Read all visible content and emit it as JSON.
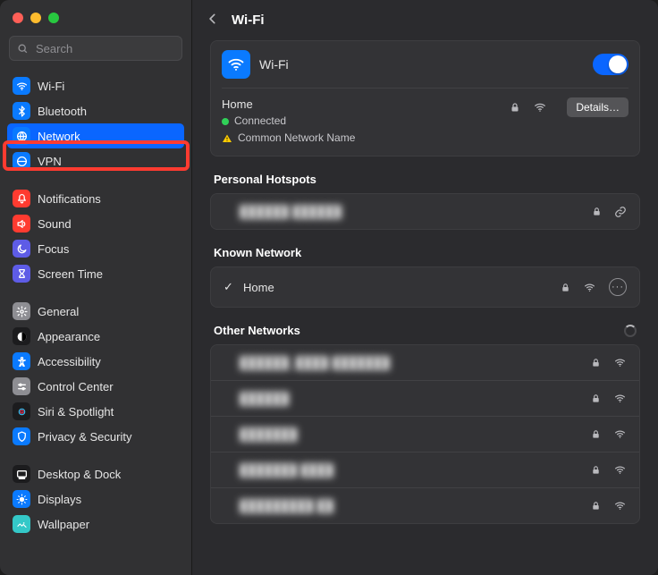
{
  "search": {
    "placeholder": "Search"
  },
  "sidebar": {
    "groups": [
      {
        "items": [
          {
            "label": "Wi-Fi",
            "icon": "wifi",
            "bg": "#0a7aff",
            "sel": false
          },
          {
            "label": "Bluetooth",
            "icon": "bt",
            "bg": "#0a7aff",
            "sel": false
          },
          {
            "label": "Network",
            "icon": "globe",
            "bg": "#0a7aff",
            "sel": true
          },
          {
            "label": "VPN",
            "icon": "vpn",
            "bg": "#0a7aff",
            "sel": false
          }
        ]
      },
      {
        "items": [
          {
            "label": "Notifications",
            "icon": "bell",
            "bg": "#ff3b30"
          },
          {
            "label": "Sound",
            "icon": "sound",
            "bg": "#ff3b30"
          },
          {
            "label": "Focus",
            "icon": "moon",
            "bg": "#5e5ce6"
          },
          {
            "label": "Screen Time",
            "icon": "hour",
            "bg": "#5e5ce6"
          }
        ]
      },
      {
        "items": [
          {
            "label": "General",
            "icon": "gear",
            "bg": "#8e8e93"
          },
          {
            "label": "Appearance",
            "icon": "appear",
            "bg": "#1c1c1e"
          },
          {
            "label": "Accessibility",
            "icon": "access",
            "bg": "#0a7aff"
          },
          {
            "label": "Control Center",
            "icon": "cc",
            "bg": "#8e8e93"
          },
          {
            "label": "Siri & Spotlight",
            "icon": "siri",
            "bg": "#1c1c1e"
          },
          {
            "label": "Privacy & Security",
            "icon": "hand",
            "bg": "#0a7aff"
          }
        ]
      },
      {
        "items": [
          {
            "label": "Desktop & Dock",
            "icon": "dock",
            "bg": "#1c1c1e"
          },
          {
            "label": "Displays",
            "icon": "display",
            "bg": "#0a7aff"
          },
          {
            "label": "Wallpaper",
            "icon": "wall",
            "bg": "#34c8c8"
          }
        ]
      }
    ]
  },
  "header": {
    "title": "Wi-Fi"
  },
  "wifi_card": {
    "title": "Wi-Fi",
    "enabled": true,
    "network_name": "Home",
    "status_text": "Connected",
    "warning_text": "Common Network Name",
    "details_button": "Details…"
  },
  "personal_hotspots": {
    "title": "Personal Hotspots",
    "items": [
      {
        "label_masked": "██████ ██████",
        "locked": true
      }
    ]
  },
  "known_networks": {
    "title": "Known Network",
    "items": [
      {
        "label": "Home",
        "checked": true,
        "locked": true,
        "signal": true
      }
    ]
  },
  "other_networks": {
    "title": "Other Networks",
    "loading": true,
    "items": [
      {
        "label_masked": "██████_████-███████",
        "locked": true
      },
      {
        "label_masked": "██████",
        "locked": true
      },
      {
        "label_masked": "███████",
        "locked": true
      },
      {
        "label_masked": "███████ ████",
        "locked": true
      },
      {
        "label_masked": "█████████ ██",
        "locked": true
      }
    ]
  }
}
